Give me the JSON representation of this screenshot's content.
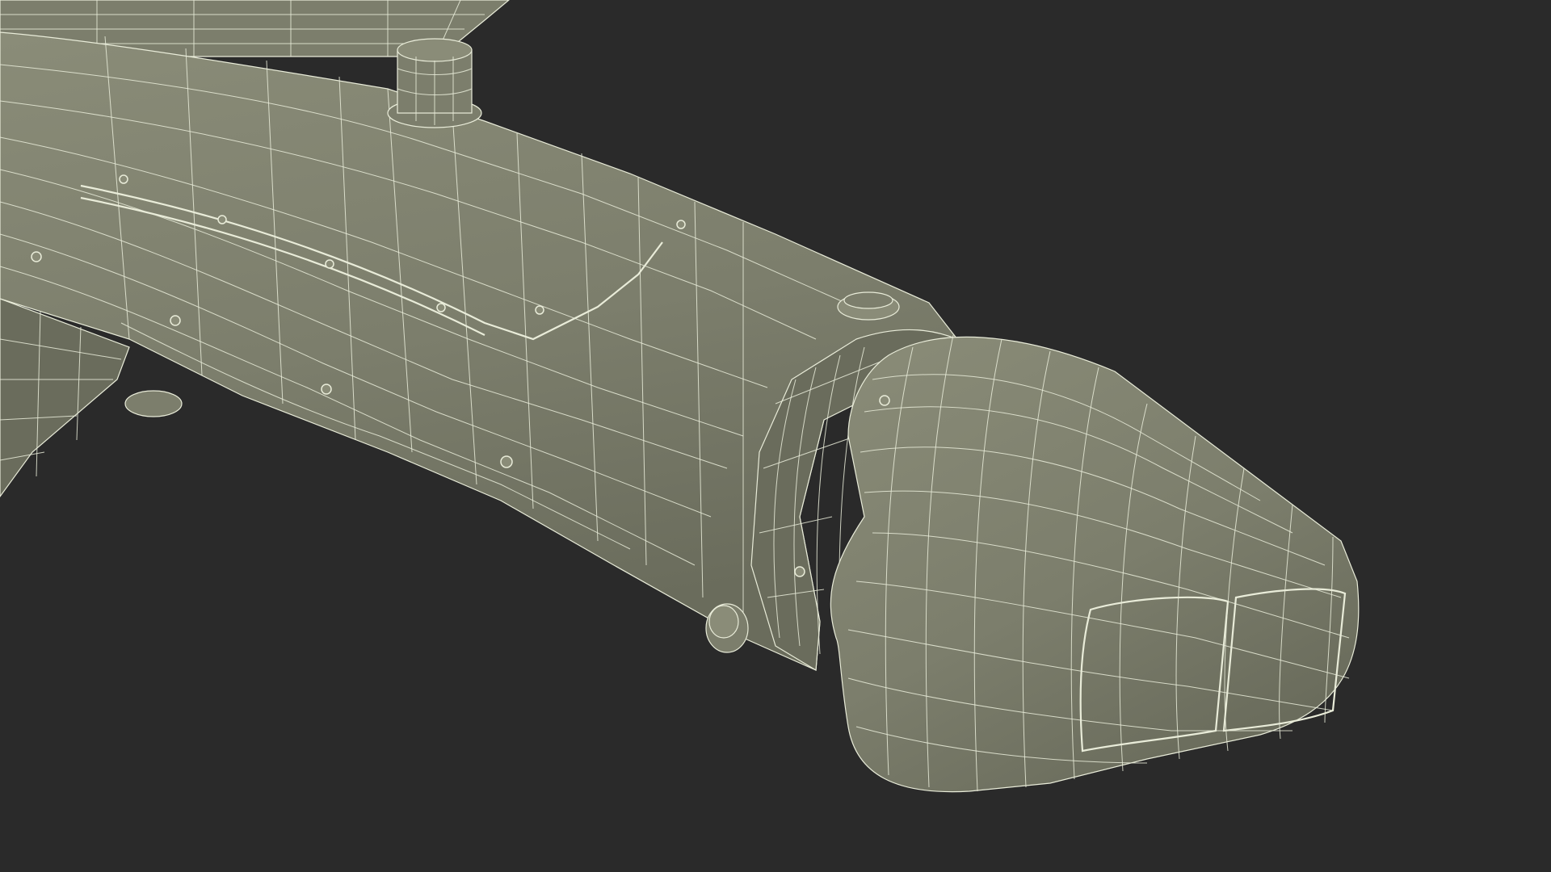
{
  "scene": {
    "background_color": "#2a2a2a",
    "surface_color": "#7c7e6c",
    "surface_shadow_color": "#6a6c5c",
    "surface_highlight_color": "#8a8c78",
    "wire_color": "#e9ecd9",
    "subject": "wireframe-missile-model"
  }
}
